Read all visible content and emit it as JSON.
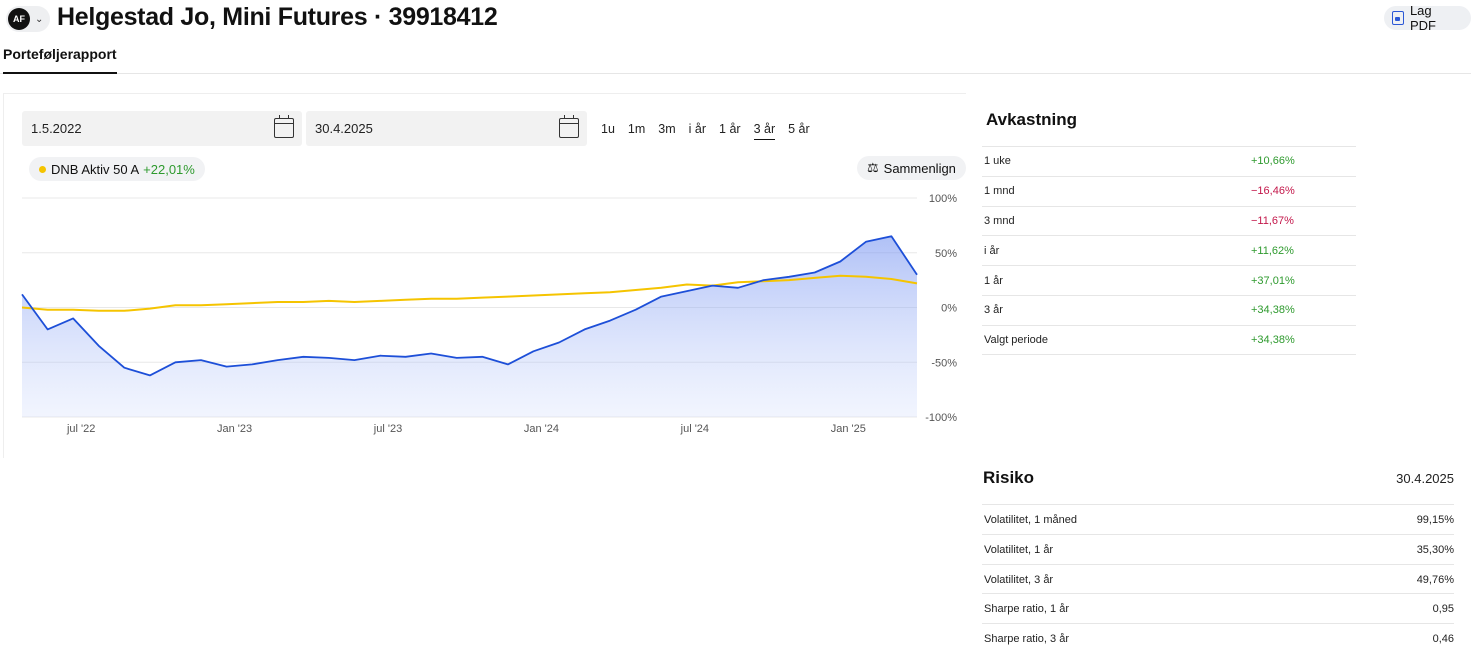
{
  "header": {
    "account_badge": "AF",
    "title": "Helgestad Jo, Mini Futures · 39918412",
    "pdf_label": "Lag PDF"
  },
  "tabs": [
    {
      "label": "Porteføljerapport",
      "active": true
    }
  ],
  "filters": {
    "from_date": "1.5.2022",
    "to_date": "30.4.2025",
    "periods": [
      {
        "label": "1u",
        "active": false
      },
      {
        "label": "1m",
        "active": false
      },
      {
        "label": "3m",
        "active": false
      },
      {
        "label": "i år",
        "active": false
      },
      {
        "label": "1 år",
        "active": false
      },
      {
        "label": "3 år",
        "active": true
      },
      {
        "label": "5 år",
        "active": false
      }
    ]
  },
  "benchmark": {
    "name": "DNB Aktiv 50 A",
    "value": "+22,01%",
    "color": "#f5c400"
  },
  "compare_label": "Sammenlign",
  "chart_data": {
    "type": "line",
    "x_ticks": [
      "jul '22",
      "Jan '23",
      "jul '23",
      "Jan '24",
      "jul '24",
      "Jan '25"
    ],
    "y_ticks": [
      "100%",
      "50%",
      "0%",
      "-50%",
      "-100%"
    ],
    "ylim": [
      -100,
      100
    ],
    "x": [
      "2022-05",
      "2022-06",
      "2022-07",
      "2022-08",
      "2022-09",
      "2022-10",
      "2022-11",
      "2022-12",
      "2023-01",
      "2023-02",
      "2023-03",
      "2023-04",
      "2023-05",
      "2023-06",
      "2023-07",
      "2023-08",
      "2023-09",
      "2023-10",
      "2023-11",
      "2023-12",
      "2024-01",
      "2024-02",
      "2024-03",
      "2024-04",
      "2024-05",
      "2024-06",
      "2024-07",
      "2024-08",
      "2024-09",
      "2024-10",
      "2024-11",
      "2024-12",
      "2025-01",
      "2025-02",
      "2025-03",
      "2025-04"
    ],
    "series": [
      {
        "name": "",
        "color": "#1d4fd8",
        "values": [
          12,
          -20,
          -10,
          -35,
          -55,
          -62,
          -50,
          -48,
          -54,
          -52,
          -48,
          -45,
          -46,
          -48,
          -44,
          -45,
          -42,
          -46,
          -45,
          -52,
          -40,
          -32,
          -20,
          -12,
          -2,
          10,
          15,
          20,
          18,
          25,
          28,
          32,
          42,
          60,
          65,
          30
        ]
      },
      {
        "name": "DNB Aktiv 50 A",
        "color": "#f5c400",
        "values": [
          0,
          -2,
          -2,
          -3,
          -3,
          -1,
          2,
          2,
          3,
          4,
          5,
          5,
          6,
          5,
          6,
          7,
          8,
          8,
          9,
          10,
          11,
          12,
          13,
          14,
          16,
          18,
          21,
          20,
          23,
          24,
          25,
          27,
          29,
          28,
          26,
          22
        ]
      }
    ]
  },
  "returns": {
    "title": "Avkastning",
    "rows": [
      {
        "label": "1 uke",
        "value": "+10,66%",
        "sign": "pos"
      },
      {
        "label": "1 mnd",
        "value": "−16,46%",
        "sign": "neg"
      },
      {
        "label": "3 mnd",
        "value": "−11,67%",
        "sign": "neg"
      },
      {
        "label": "i år",
        "value": "+11,62%",
        "sign": "pos"
      },
      {
        "label": "1 år",
        "value": "+37,01%",
        "sign": "pos"
      },
      {
        "label": "3 år",
        "value": "+34,38%",
        "sign": "pos"
      },
      {
        "label": "Valgt periode",
        "value": "+34,38%",
        "sign": "pos"
      }
    ]
  },
  "risk": {
    "title": "Risiko",
    "date": "30.4.2025",
    "rows": [
      {
        "label": "Volatilitet, 1 måned",
        "value": "99,15%"
      },
      {
        "label": "Volatilitet, 1 år",
        "value": "35,30%"
      },
      {
        "label": "Volatilitet, 3 år",
        "value": "49,76%"
      },
      {
        "label": "Sharpe ratio, 1 år",
        "value": "0,95"
      },
      {
        "label": "Sharpe ratio, 3 år",
        "value": "0,46"
      }
    ]
  }
}
